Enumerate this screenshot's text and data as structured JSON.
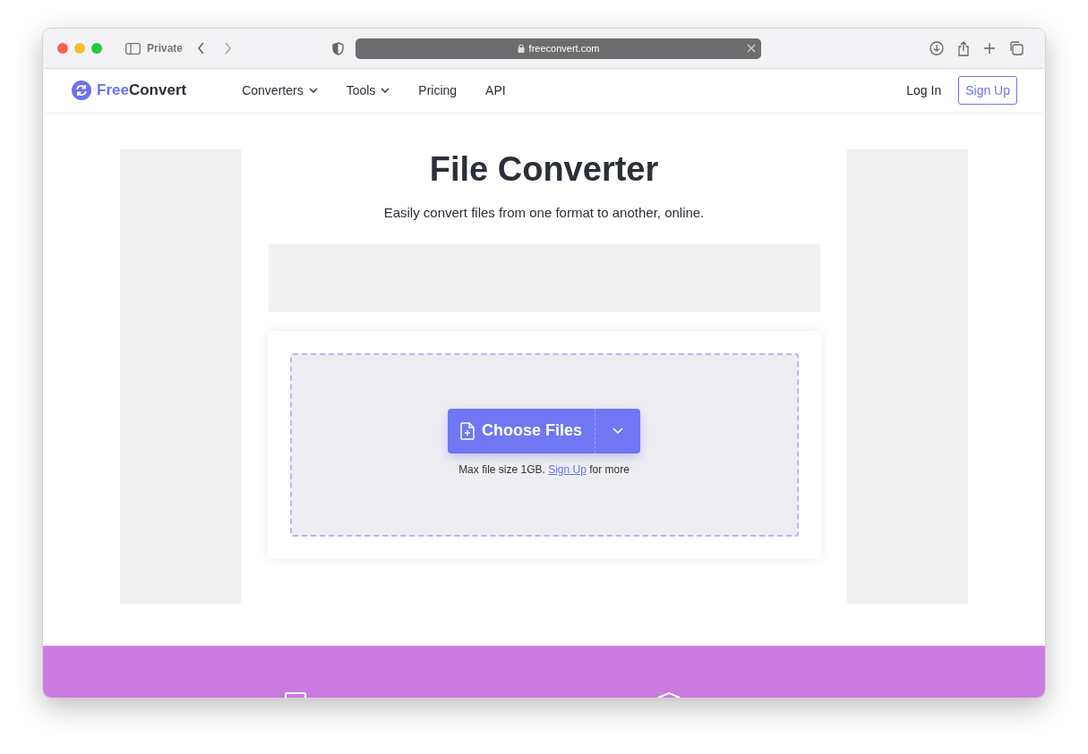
{
  "browser": {
    "private_label": "Private",
    "url": "freeconvert.com"
  },
  "nav": {
    "brand_first": "Free",
    "brand_second": "Convert",
    "items": [
      {
        "label": "Converters",
        "kind": "dropdown"
      },
      {
        "label": "Tools",
        "kind": "dropdown"
      },
      {
        "label": "Pricing",
        "kind": "link"
      },
      {
        "label": "API",
        "kind": "link"
      }
    ],
    "login": "Log In",
    "signup": "Sign Up"
  },
  "hero": {
    "title": "File Converter",
    "subtitle": "Easily convert files from one format to another, online."
  },
  "upload": {
    "button": "Choose Files",
    "note_before": "Max file size 1GB.",
    "note_link": "Sign Up",
    "note_after": "for more"
  }
}
